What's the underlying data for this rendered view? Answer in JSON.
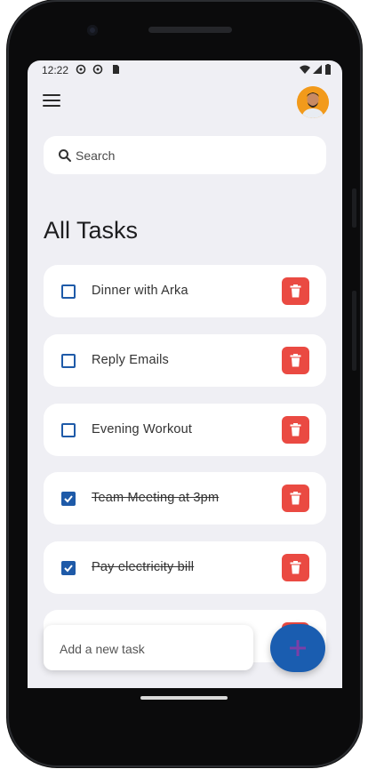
{
  "status_bar": {
    "time": "12:22"
  },
  "search": {
    "label": "Search"
  },
  "heading": "All Tasks",
  "tasks": [
    {
      "label": "Dinner with Arka",
      "done": false
    },
    {
      "label": "Reply Emails",
      "done": false
    },
    {
      "label": "Evening Workout",
      "done": false
    },
    {
      "label": "Team Meeting at 3pm",
      "done": true
    },
    {
      "label": "Pay electricity bill",
      "done": true
    }
  ],
  "add_task": {
    "placeholder": "Add a new task"
  },
  "colors": {
    "accent": "#1a5db0",
    "delete": "#ea4a42",
    "background": "#efeff4"
  },
  "icons": {
    "menu": "menu-icon",
    "search": "search-icon",
    "delete": "trash-icon",
    "add": "plus-icon",
    "checkbox": "checkbox-icon"
  }
}
